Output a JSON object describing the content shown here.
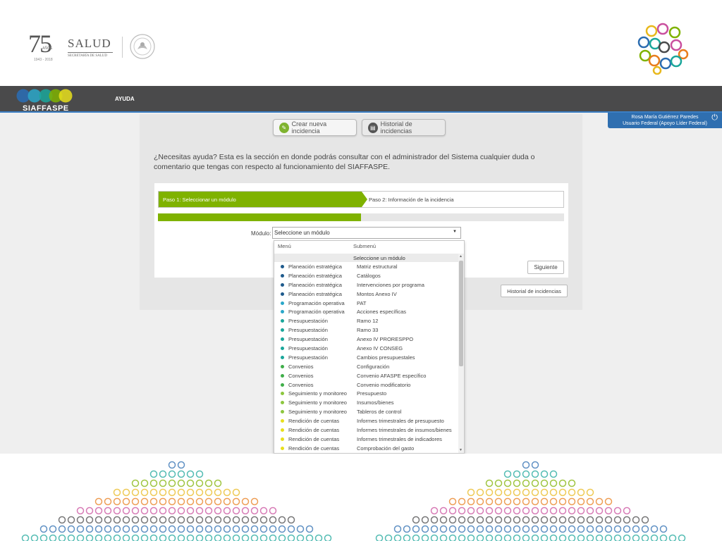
{
  "header": {
    "anniversary": {
      "number": "75",
      "word": "AÑOS",
      "years": "1943 - 2018"
    },
    "salud": {
      "title": "SALUD",
      "subtitle": "SECRETARÍA DE SALUD"
    }
  },
  "nav": {
    "brand": "SIAFFASPE",
    "items": [
      {
        "label": "AYUDA"
      }
    ]
  },
  "user": {
    "name": "Rosa María Gutiérrez Paredes",
    "role": "Usuario Federal (Apoyo Líder Federal)",
    "logout_icon": "power-icon"
  },
  "actions": {
    "crear_label": "Crear nueva incidencia",
    "crear_icon": "pencil-icon",
    "historial_label": "Historial de incidencias",
    "historial_icon": "list-icon"
  },
  "help_text": "¿Necesitas ayuda? Esta es la sección en donde podrás consultar con el administrador del Sistema cualquier duda o comentario que tengas con respecto al funcionamiento del SIAFFASPE.",
  "wizard": {
    "step1": "Paso 1: Seleccionar un módulo",
    "step2": "Paso 2: Información de la incidencia",
    "progress": 0.5,
    "modulo_label": "Módulo:",
    "modulo_value": "Seleccione un módulo",
    "siguiente_label": "Siguiente",
    "historial_label": "Historial de incidencias"
  },
  "dropdown": {
    "col_menu": "Menú",
    "col_submenu": "Submenú",
    "placeholder": "Seleccione un módulo",
    "rows": [
      {
        "menu": "Planeación estratégica",
        "sub": "Matriz estructural",
        "color": "#1e5a8c"
      },
      {
        "menu": "Planeación estratégica",
        "sub": "Catálogos",
        "color": "#1e5a8c"
      },
      {
        "menu": "Planeación estratégica",
        "sub": "Intervenciones por programa",
        "color": "#1e5a8c"
      },
      {
        "menu": "Planeación estratégica",
        "sub": "Montos Anexo IV",
        "color": "#1e5a8c"
      },
      {
        "menu": "Programación operativa",
        "sub": "PAT",
        "color": "#2aa7c9"
      },
      {
        "menu": "Programación operativa",
        "sub": "Acciones específicas",
        "color": "#2aa7c9"
      },
      {
        "menu": "Presupuestación",
        "sub": "Ramo 12",
        "color": "#1aa69a"
      },
      {
        "menu": "Presupuestación",
        "sub": "Ramo 33",
        "color": "#1aa69a"
      },
      {
        "menu": "Presupuestación",
        "sub": "Anexo IV PRORESPPO",
        "color": "#1aa69a"
      },
      {
        "menu": "Presupuestación",
        "sub": "Anexo IV CONSEG",
        "color": "#1aa69a"
      },
      {
        "menu": "Presupuestación",
        "sub": "Cambios presupuestales",
        "color": "#1aa69a"
      },
      {
        "menu": "Convenios",
        "sub": "Configuración",
        "color": "#3fae49"
      },
      {
        "menu": "Convenios",
        "sub": "Convenio AFASPE específico",
        "color": "#3fae49"
      },
      {
        "menu": "Convenios",
        "sub": "Convenio modificatorio",
        "color": "#3fae49"
      },
      {
        "menu": "Seguimiento y monitoreo",
        "sub": "Presupuesto",
        "color": "#8cc63e"
      },
      {
        "menu": "Seguimiento y monitoreo",
        "sub": "Insumos/bienes",
        "color": "#8cc63e"
      },
      {
        "menu": "Seguimiento y monitoreo",
        "sub": "Tableros de control",
        "color": "#8cc63e"
      },
      {
        "menu": "Rendición de cuentas",
        "sub": "Informes trimestrales de presupuesto",
        "color": "#e8df1c"
      },
      {
        "menu": "Rendición de cuentas",
        "sub": "Informes trimestrales de insumos/bienes",
        "color": "#e8df1c"
      },
      {
        "menu": "Rendición de cuentas",
        "sub": "Informes trimestrales de indicadores",
        "color": "#e8df1c"
      },
      {
        "menu": "Rendición de cuentas",
        "sub": "Comprobación del gasto",
        "color": "#e8df1c"
      }
    ]
  },
  "palette": {
    "accent_green": "#7fb200",
    "nav_dark": "#4a4a4b",
    "user_blue": "#2f6fb0",
    "logo_colors": [
      "#2b6cb0",
      "#1aa69a",
      "#7fb200",
      "#e8b81c",
      "#e87d1c",
      "#c94f9e",
      "#4a4a4b"
    ]
  }
}
